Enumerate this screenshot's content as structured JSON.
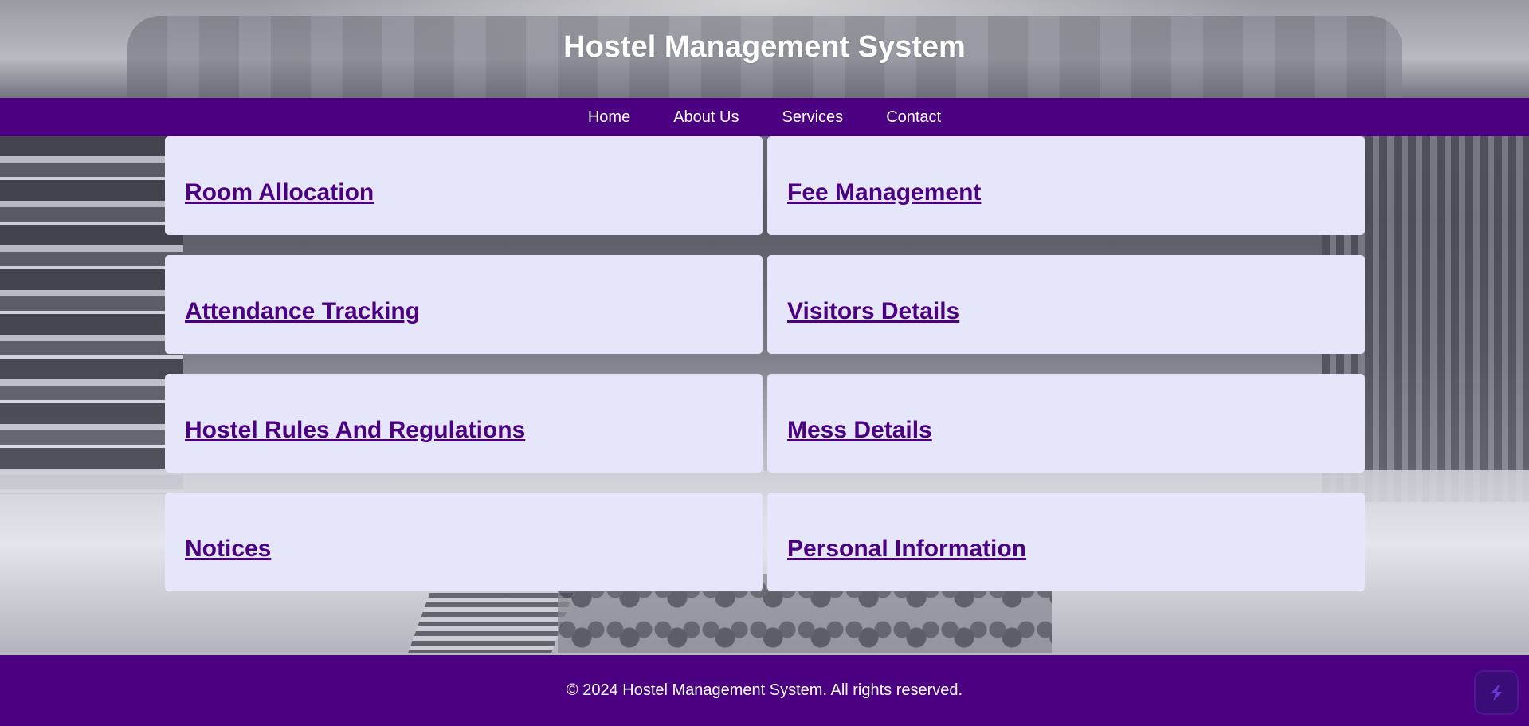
{
  "header": {
    "title": "Hostel Management System"
  },
  "nav": {
    "items": [
      {
        "label": "Home"
      },
      {
        "label": "About Us"
      },
      {
        "label": "Services"
      },
      {
        "label": "Contact"
      }
    ]
  },
  "cards": [
    {
      "label": "Room Allocation"
    },
    {
      "label": "Fee Management"
    },
    {
      "label": "Attendance Tracking"
    },
    {
      "label": "Visitors Details"
    },
    {
      "label": "Hostel Rules And Regulations"
    },
    {
      "label": "Mess Details"
    },
    {
      "label": "Notices"
    },
    {
      "label": "Personal Information"
    }
  ],
  "footer": {
    "text": "© 2024 Hostel Management System. All rights reserved."
  },
  "floating_button": {
    "icon": "extension-logo-icon"
  },
  "colors": {
    "primary": "#4b0082",
    "card_bg": "#e6e6fa",
    "text_light": "#ffffff"
  }
}
